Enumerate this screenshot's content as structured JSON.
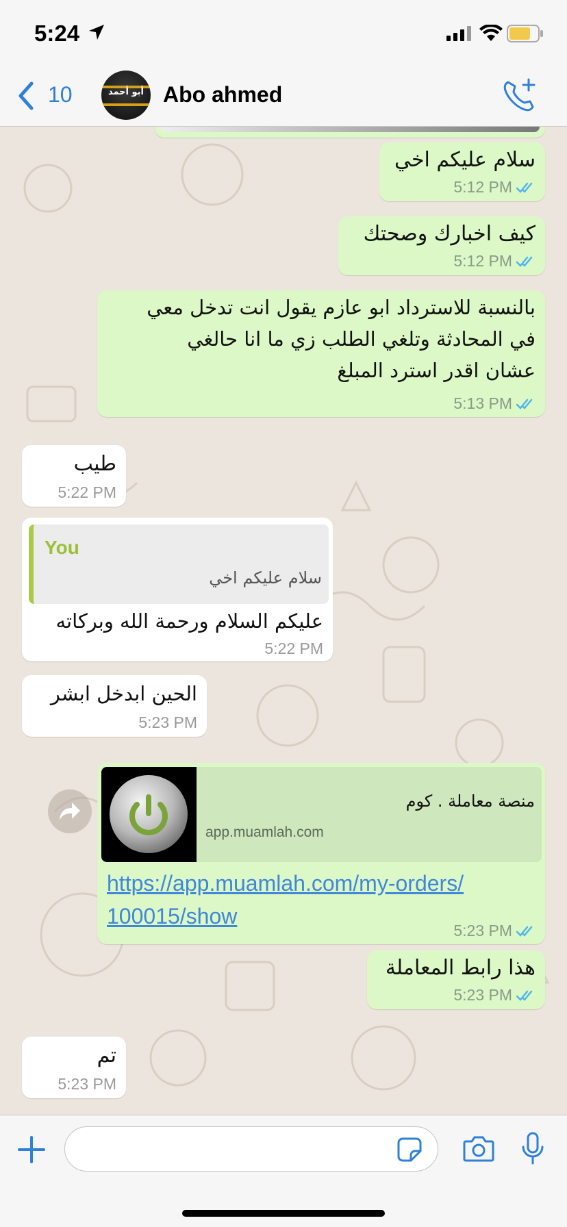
{
  "status_bar": {
    "time": "5:24",
    "battery_color": "#f2c94c"
  },
  "header": {
    "back_count": "10",
    "contact_name": "Abo ahmed",
    "avatar_text": "أبو أحمد",
    "accent": "#2f80d8"
  },
  "messages": [
    {
      "text": "سلام عليكم اخي",
      "time": "5:12 PM"
    },
    {
      "text": "كيف اخبارك وصحتك",
      "time": "5:12 PM"
    },
    {
      "lines": [
        "بالنسبة للاسترداد ابو عازم يقول انت تدخل معي",
        "في المحادثة وتلغي الطلب زي ما انا حالغي",
        "عشان اقدر استرد المبلغ"
      ],
      "time": "5:13 PM"
    },
    {
      "text": "طيب",
      "time": "5:22 PM"
    },
    {
      "quote_author": "You",
      "quote_text": "سلام عليكم اخي",
      "text": "عليكم السلام ورحمة الله وبركاته",
      "time": "5:22 PM"
    },
    {
      "text": "الحين ابدخل  ابشر",
      "time": "5:23 PM"
    },
    {
      "preview_title": "منصة معاملة . كوم",
      "preview_domain": "app.muamlah.com",
      "link": "https://app.muamlah.com/my-orders/100015/show",
      "link_line1": "https://app.muamlah.com/my-orders/",
      "link_line2": "100015/show",
      "time": "5:23 PM"
    },
    {
      "text": "هذا رابط المعاملة",
      "time": "5:23 PM"
    },
    {
      "text": "تم",
      "time": "5:23 PM"
    }
  ],
  "composer": {
    "placeholder": ""
  },
  "colors": {
    "outgoing": "#dcf8c6",
    "incoming": "#ffffff",
    "read_ticks": "#4fb6ec",
    "quote_bar": "#a9c94a"
  },
  "icons": [
    "location-arrow-icon",
    "signal-icon",
    "wifi-icon",
    "battery-icon",
    "back-chevron-icon",
    "add-call-icon",
    "forward-icon",
    "plus-icon",
    "sticker-icon",
    "camera-icon",
    "microphone-icon"
  ]
}
